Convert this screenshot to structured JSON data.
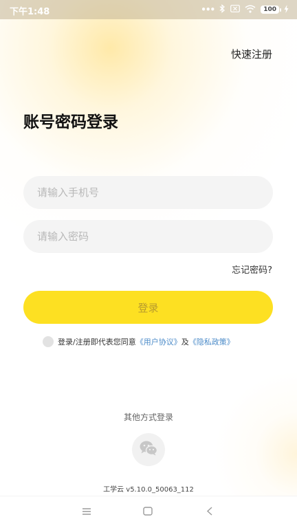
{
  "status_bar": {
    "time": "下午1:48",
    "signal_dots": "•••",
    "battery": "100"
  },
  "header": {
    "register_label": "快速注册"
  },
  "main": {
    "title": "账号密码登录",
    "phone_placeholder": "请输入手机号",
    "password_placeholder": "请输入密码",
    "forgot_label": "忘记密码?",
    "login_label": "登录",
    "agreement": {
      "prefix": "登录/注册即代表您同意",
      "user_agreement": "《用户协议》",
      "conjunction": "及",
      "privacy_policy": "《隐私政策》"
    }
  },
  "footer": {
    "other_login_label": "其他方式登录",
    "version": "工学云 v5.10.0_50063_112"
  },
  "colors": {
    "accent": "#fde022",
    "link": "#4a8ac8"
  }
}
